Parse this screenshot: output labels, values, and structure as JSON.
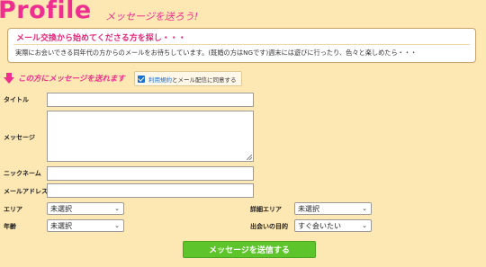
{
  "header": {
    "title": "Profile",
    "subtitle": "メッセージを送ろう!"
  },
  "intro": {
    "heading": "メール交換から始めてくださる方を探し・・・",
    "body": "実際にお会いできる同年代の方からのメールをお待ちしています。(既婚の方はNGです)週末には遊びに行ったり、色々と楽しめたら・・・"
  },
  "send_label": "この方にメッセージを送れます",
  "agree": {
    "checked": true,
    "link_text": "利用規約",
    "rest_text": "とメール配信に同意する"
  },
  "form": {
    "title_label": "タイトル",
    "title_value": "",
    "message_label": "メッセージ",
    "message_value": "",
    "nickname_label": "ニックネーム",
    "nickname_value": "",
    "email_label": "メールアドレス",
    "email_value": "",
    "area_label": "エリア",
    "area_value": "未選択",
    "detail_area_label": "詳細エリア",
    "detail_area_value": "未選択",
    "age_label": "年齢",
    "age_value": "未選択",
    "purpose_label": "出会いの目的",
    "purpose_value": "すぐ会いたい"
  },
  "submit_label": "メッセージを送信する",
  "colors": {
    "accent": "#ee2f8f",
    "background": "#fde7b3",
    "submit": "#5ec42b"
  }
}
